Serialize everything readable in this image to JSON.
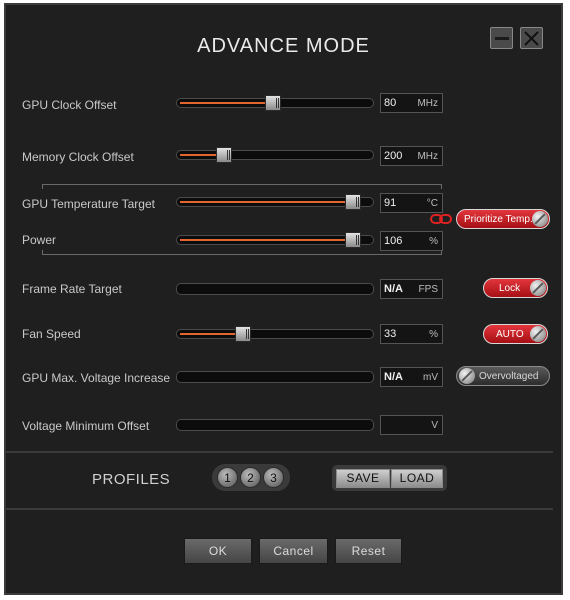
{
  "window": {
    "title": "ADVANCE MODE",
    "minimize_icon": "minimize-icon",
    "close_icon": "close-icon"
  },
  "colors": {
    "background": "#1f1f1f",
    "slider_fill": "#e0652f",
    "toggle_active": "#c8151b",
    "label": "#c9c9c9"
  },
  "settings": {
    "gpu_clock_offset": {
      "label": "GPU Clock Offset",
      "value": "80",
      "unit": "MHz"
    },
    "memory_clock_offset": {
      "label": "Memory Clock Offset",
      "value": "200",
      "unit": "MHz"
    },
    "gpu_temperature_target": {
      "label": "GPU Temperature Target",
      "value": "91",
      "unit": "°C"
    },
    "power": {
      "label": "Power",
      "value": "106",
      "unit": "%"
    },
    "frame_rate_target": {
      "label": "Frame Rate Target",
      "value": "N/A",
      "unit": "FPS"
    },
    "fan_speed": {
      "label": "Fan Speed",
      "value": "33",
      "unit": "%"
    },
    "gpu_max_voltage_increase": {
      "label": "GPU Max. Voltage Increase",
      "value": "N/A",
      "unit": "mV"
    },
    "voltage_minimum_offset": {
      "label": "Voltage Minimum Offset",
      "value": "",
      "unit": "V"
    }
  },
  "slider_levels": {
    "gpu_clock_offset": 0.49,
    "memory_clock_offset": 0.23,
    "gpu_temperature_target": 0.91,
    "power": 0.91,
    "fan_speed": 0.33
  },
  "toggles": {
    "prioritize_temp": {
      "label": "Prioritize Temp.",
      "state": "on"
    },
    "frame_rate_lock": {
      "label": "Lock",
      "state": "on"
    },
    "fan_auto": {
      "label": "AUTO",
      "state": "on"
    },
    "overvoltaged": {
      "label": "Overvoltaged",
      "state": "off"
    }
  },
  "profiles": {
    "label": "PROFILES",
    "slots": [
      "1",
      "2",
      "3"
    ],
    "save_label": "SAVE",
    "load_label": "LOAD"
  },
  "footer": {
    "ok_label": "OK",
    "cancel_label": "Cancel",
    "reset_label": "Reset"
  }
}
